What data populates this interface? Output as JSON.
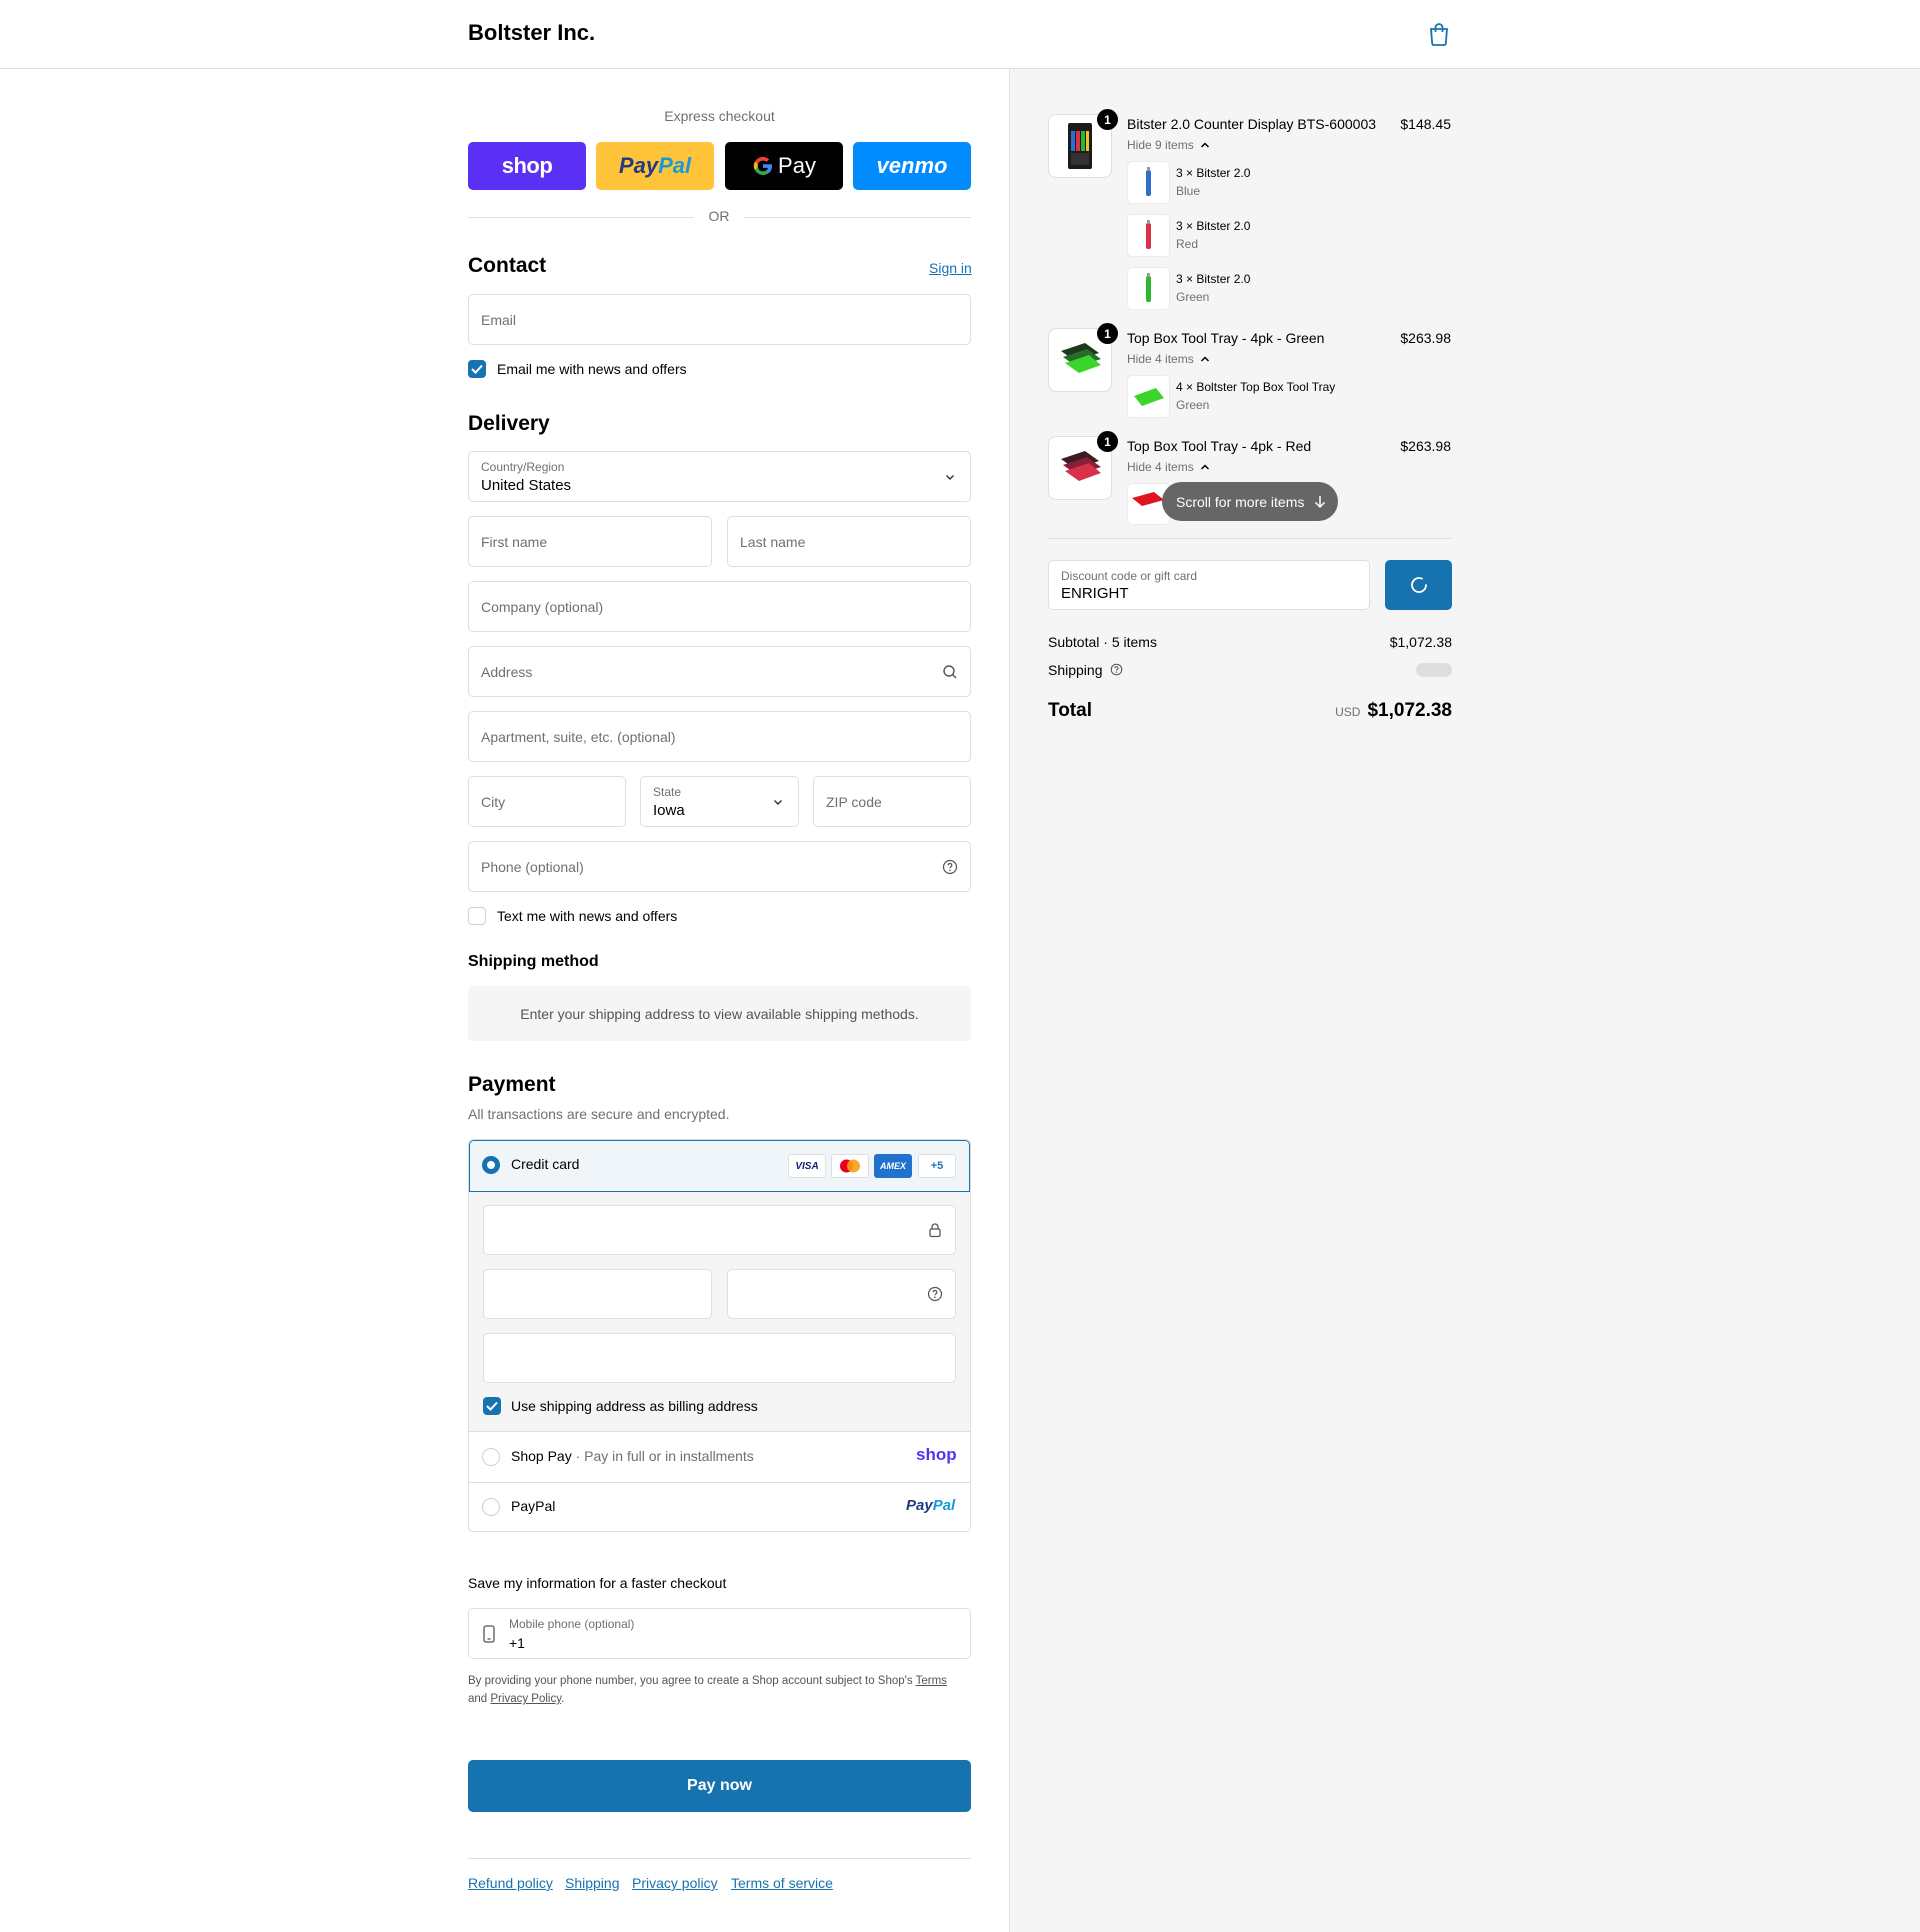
{
  "header": {
    "brand": "Boltster Inc.",
    "cart_icon": "shopping-bag-icon"
  },
  "express": {
    "title": "Express checkout",
    "shop_label": "shop",
    "paypal_label_a": "Pay",
    "paypal_label_b": "Pal",
    "gpay_label": "Pay",
    "venmo_label": "venmo",
    "or": "OR"
  },
  "contact": {
    "title": "Contact",
    "sign_in": "Sign in",
    "email_placeholder": "Email",
    "email_news": "Email me with news and offers",
    "email_news_checked": true
  },
  "delivery": {
    "title": "Delivery",
    "country_label": "Country/Region",
    "country_value": "United States",
    "first_name": "First name",
    "last_name": "Last name",
    "company": "Company (optional)",
    "address": "Address",
    "apartment": "Apartment, suite, etc. (optional)",
    "city": "City",
    "state_label": "State",
    "state_value": "Iowa",
    "zip": "ZIP code",
    "phone": "Phone (optional)",
    "text_news": "Text me with news and offers",
    "text_news_checked": false
  },
  "shipping_method": {
    "title": "Shipping method",
    "notice": "Enter your shipping address to view available shipping methods."
  },
  "payment": {
    "title": "Payment",
    "subtitle": "All transactions are secure and encrypted.",
    "credit_card": "Credit card",
    "card_brands": [
      "VISA",
      "AMEX"
    ],
    "more_brands": "+5",
    "billing_same": "Use shipping address as billing address",
    "shop_pay": "Shop Pay",
    "shop_pay_sep": "·",
    "shop_pay_desc": "Pay in full or in installments",
    "shop_logo": "shop",
    "paypal": "PayPal",
    "paypal_logo_a": "Pay",
    "paypal_logo_b": "Pal"
  },
  "save_info": {
    "title": "Save my information for a faster checkout",
    "mobile_label": "Mobile phone (optional)",
    "mobile_value": "+1",
    "disclaimer_a": "By providing your phone number, you agree to create a Shop account subject to Shop's",
    "terms": "Terms",
    "and": "and",
    "privacy": "Privacy Policy",
    "period": "."
  },
  "pay_now": "Pay now",
  "footer_links": [
    "Refund policy",
    "Shipping",
    "Privacy policy",
    "Terms of service"
  ],
  "cart": {
    "items": [
      {
        "name": "Bitster 2.0 Counter Display BTS-600003",
        "price": "$148.45",
        "qty": "1",
        "toggle": "Hide 9 items",
        "subitems": [
          {
            "name": "3 × Bitster 2.0",
            "variant": "Blue",
            "color": "#2d6fd1"
          },
          {
            "name": "3 × Bitster 2.0",
            "variant": "Red",
            "color": "#d8314a"
          },
          {
            "name": "3 × Bitster 2.0",
            "variant": "Green",
            "color": "#2fb52f"
          }
        ]
      },
      {
        "name": "Top Box Tool Tray - 4pk - Green",
        "price": "$263.98",
        "qty": "1",
        "toggle": "Hide 4 items",
        "subitems": [
          {
            "name": "4 × Boltster Top Box Tool Tray",
            "variant": "Green",
            "color": "#3bd42a"
          }
        ]
      },
      {
        "name": "Top Box Tool Tray - 4pk - Red",
        "price": "$263.98",
        "qty": "1",
        "toggle": "Hide 4 items"
      }
    ],
    "scroll_hint": "Scroll for more items",
    "discount_label": "Discount code or gift card",
    "discount_value": "ENRIGHT",
    "subtotal_label": "Subtotal · 5 items",
    "subtotal_value": "$1,072.38",
    "shipping_label": "Shipping",
    "total_label": "Total",
    "currency": "USD",
    "total_value": "$1,072.38"
  },
  "colors": {
    "accent": "#1773b0",
    "shop_purple": "#5a31f4",
    "paypal_yellow": "#ffc439",
    "venmo_blue": "#008cff"
  }
}
